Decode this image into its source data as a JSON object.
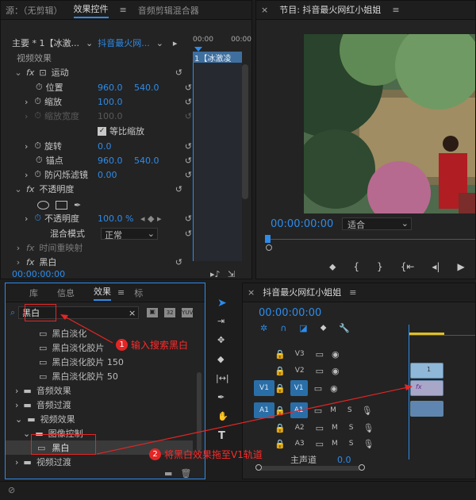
{
  "effect_controls": {
    "tabs": [
      "源：（无剪辑）",
      "效果控件",
      "音频剪辑混合器"
    ],
    "master": "主要 * 1【冰激...",
    "sequence": "抖音最火网...",
    "ruler_time": [
      "00:00",
      "00:00"
    ],
    "clip_label": "1【冰激凌",
    "video_effects_label": "视频效果",
    "motion_label": "运动",
    "position": {
      "label": "位置",
      "x": "960.0",
      "y": "540.0"
    },
    "scale": {
      "label": "缩放",
      "value": "100.0"
    },
    "scale_width": {
      "label": "缩放宽度",
      "value": "100.0"
    },
    "uniform_scale": "等比缩放",
    "rotation": {
      "label": "旋转",
      "value": "0.0"
    },
    "anchor": {
      "label": "锚点",
      "x": "960.0",
      "y": "540.0"
    },
    "anti_flicker": {
      "label": "防闪烁滤镜",
      "value": "0.00"
    },
    "opacity_section": "不透明度",
    "opacity": {
      "label": "不透明度",
      "value": "100.0 %"
    },
    "blend_mode": {
      "label": "混合模式",
      "value": "正常"
    },
    "time_remap": "时间重映射",
    "bw_effect": "黑白",
    "timecode": "00:00:00:00"
  },
  "program": {
    "title": "节目: 抖音最火网红小姐姐",
    "timecode": "00:00:00:00",
    "fit": "适合"
  },
  "effects_panel": {
    "tabs": [
      "库",
      "信息",
      "效果",
      "标"
    ],
    "search_value": "黑白",
    "items": [
      {
        "label": "黑白淡化",
        "indent": 2,
        "type": "preset"
      },
      {
        "label": "黑白淡化胶片",
        "indent": 2,
        "type": "preset"
      },
      {
        "label": "黑白淡化胶片 150",
        "indent": 2,
        "type": "preset"
      },
      {
        "label": "黑白淡化胶片 50",
        "indent": 2,
        "type": "preset"
      },
      {
        "label": "音频效果",
        "indent": 0,
        "type": "folder"
      },
      {
        "label": "音频过渡",
        "indent": 0,
        "type": "folder"
      },
      {
        "label": "视频效果",
        "indent": 0,
        "type": "folder-open"
      },
      {
        "label": "图像控制",
        "indent": 1,
        "type": "folder-open"
      },
      {
        "label": "黑白",
        "indent": 2,
        "type": "effect"
      },
      {
        "label": "视频过渡",
        "indent": 0,
        "type": "folder"
      }
    ]
  },
  "timeline": {
    "title": "抖音最火网红小姐姐",
    "timecode": "00:00:00:00",
    "tracks": [
      {
        "name": "V3"
      },
      {
        "name": "V2"
      },
      {
        "name": "V1",
        "src": "V1"
      },
      {
        "name": "A1",
        "src": "A1"
      },
      {
        "name": "A2"
      },
      {
        "name": "A3"
      }
    ],
    "master": "主声道",
    "master_val": "0.0",
    "m_label": "M",
    "s_label": "S"
  },
  "callouts": {
    "one": {
      "num": "1",
      "text": "输入搜索黑白"
    },
    "two": {
      "num": "2",
      "text": "将黑白效果拖至V1轨道"
    }
  },
  "colors": {
    "accent": "#2d8ceb",
    "annotation": "#e52525",
    "panel": "#232323"
  }
}
